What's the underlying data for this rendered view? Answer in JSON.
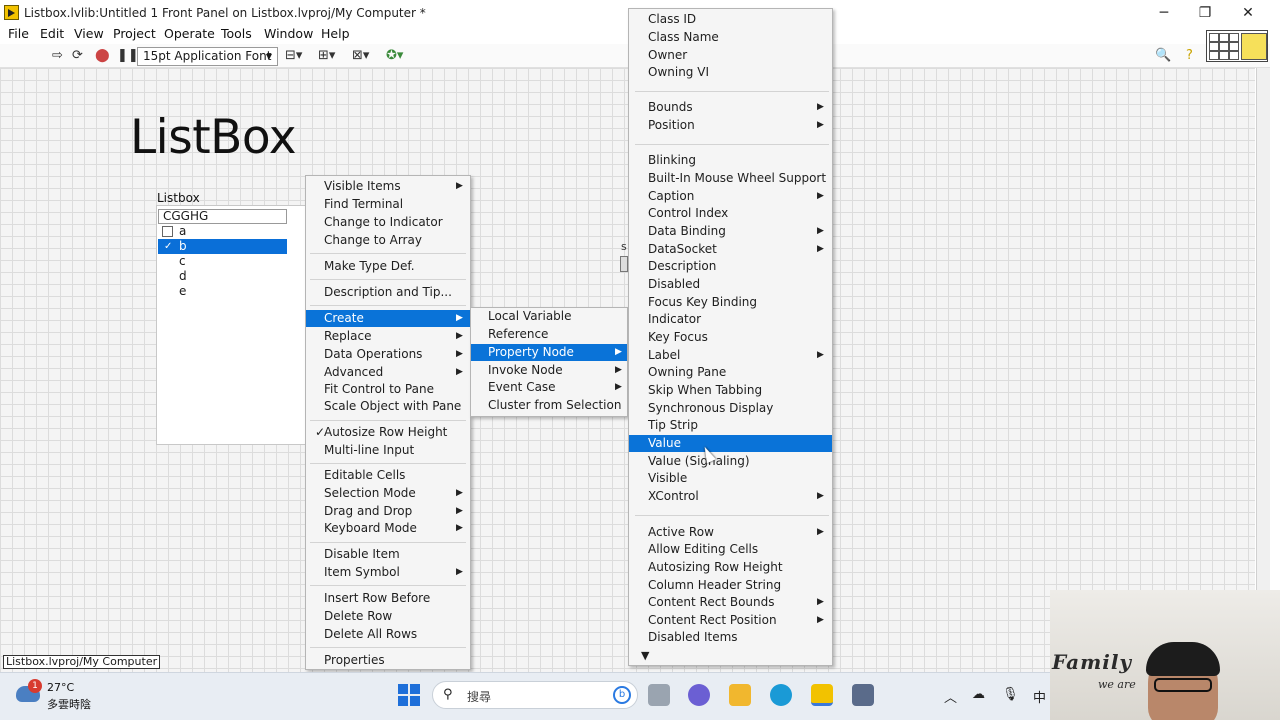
{
  "window": {
    "title": "Listbox.lvlib:Untitled 1 Front Panel on Listbox.lvproj/My Computer *",
    "minimize": "─",
    "maximize": "❐",
    "close": "✕"
  },
  "menubar": [
    "File",
    "Edit",
    "View",
    "Project",
    "Operate",
    "Tools",
    "Window",
    "Help"
  ],
  "toolbar": {
    "font": "15pt Application Font"
  },
  "panel": {
    "title": "ListBox",
    "listbox": {
      "label": "Listbox",
      "header": "CGGHG",
      "rows": [
        {
          "text": "a",
          "selected": false
        },
        {
          "text": "b",
          "selected": true
        },
        {
          "text": "c",
          "selected": false
        },
        {
          "text": "d",
          "selected": false
        },
        {
          "text": "e",
          "selected": false
        }
      ]
    },
    "small_label": "s"
  },
  "context_menu": {
    "items": [
      "Visible Items",
      "Find Terminal",
      "Change to Indicator",
      "Change to Array",
      "Make Type Def.",
      "Description and Tip...",
      "Create",
      "Replace",
      "Data Operations",
      "Advanced",
      "Fit Control to Pane",
      "Scale Object with Pane",
      "Autosize Row Height",
      "Multi-line Input",
      "Editable Cells",
      "Selection Mode",
      "Drag and Drop",
      "Keyboard Mode",
      "Disable Item",
      "Item Symbol",
      "Insert Row Before",
      "Delete Row",
      "Delete All Rows",
      "Properties"
    ],
    "check": "✓"
  },
  "create_menu": {
    "items": [
      "Local Variable",
      "Reference",
      "Property Node",
      "Invoke Node",
      "Event Case",
      "Cluster from Selection"
    ]
  },
  "property_menu": {
    "items": [
      "Class ID",
      "Class Name",
      "Owner",
      "Owning VI",
      "Bounds",
      "Position",
      "Blinking",
      "Built-In Mouse Wheel Support",
      "Caption",
      "Control Index",
      "Data Binding",
      "DataSocket",
      "Description",
      "Disabled",
      "Focus Key Binding",
      "Indicator",
      "Key Focus",
      "Label",
      "Owning Pane",
      "Skip When Tabbing",
      "Synchronous Display",
      "Tip Strip",
      "Value",
      "Value (Signaling)",
      "Visible",
      "XControl",
      "Active Row",
      "Allow Editing Cells",
      "Autosizing Row Height",
      "Column Header String",
      "Content Rect Bounds",
      "Content Rect Position",
      "Disabled Items"
    ],
    "more": "▼"
  },
  "status": "Listbox.lvproj/My Computer",
  "taskbar": {
    "badge": "1",
    "temperature": "27°C",
    "weather": "多雲時陰",
    "search_placeholder": "搜尋",
    "bing": "b",
    "ime": "中"
  },
  "webcam": {
    "logo": "Family",
    "sub": "we are"
  },
  "colors": {
    "highlight": "#0a73d8",
    "menu_bg": "#f5f5f5",
    "grid": "#dcdcdc"
  }
}
